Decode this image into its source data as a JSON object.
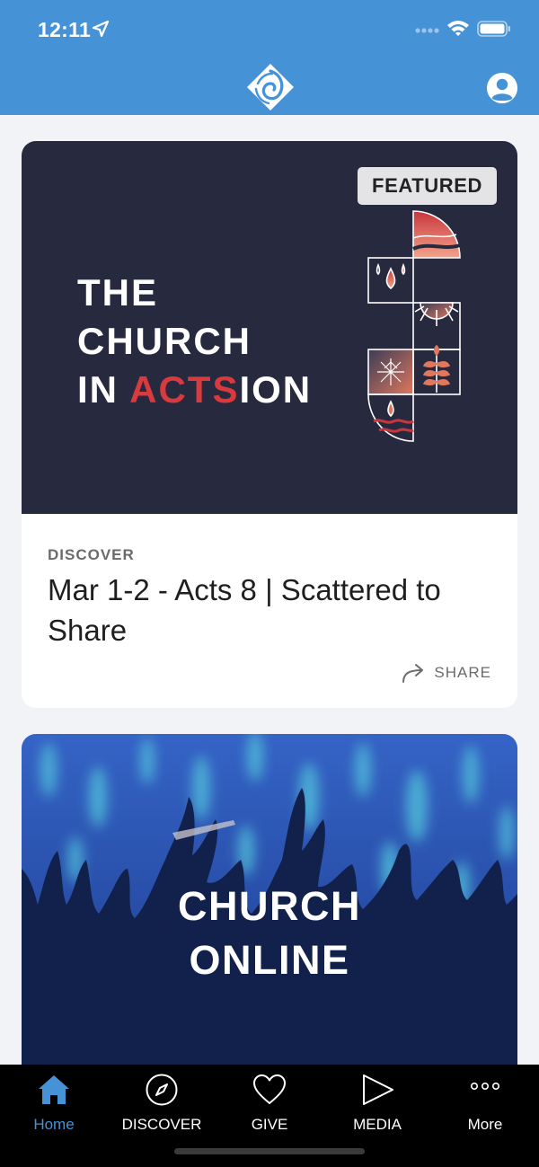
{
  "status_bar": {
    "time": "12:11"
  },
  "colors": {
    "header_blue": "#4692d6",
    "hero_navy": "#272a3f",
    "accent_red": "#d83a3d",
    "tab_bar_bg": "#000000",
    "active_tab": "#4692d6"
  },
  "header": {
    "logo_icon": "church-logo-icon",
    "profile_icon": "user-profile-icon"
  },
  "feed": {
    "featured_card": {
      "badge": "FEATURED",
      "hero_title_line1": "THE",
      "hero_title_line2": "CHURCH",
      "hero_title_line3_a": "IN ",
      "hero_title_line3_b": "ACTS",
      "hero_title_line3_c": "ION",
      "category": "DISCOVER",
      "title": "Mar 1-2 - Acts 8 | Scattered to Share",
      "share_label": "SHARE"
    },
    "online_card": {
      "title_line1": "CHURCH",
      "title_line2": "ONLINE"
    }
  },
  "tab_bar": {
    "tabs": [
      {
        "label": "Home",
        "icon": "home-icon",
        "active": true
      },
      {
        "label": "DISCOVER",
        "icon": "compass-icon",
        "active": false
      },
      {
        "label": "GIVE",
        "icon": "heart-icon",
        "active": false
      },
      {
        "label": "MEDIA",
        "icon": "play-icon",
        "active": false
      },
      {
        "label": "More",
        "icon": "more-dots-icon",
        "active": false
      }
    ]
  }
}
